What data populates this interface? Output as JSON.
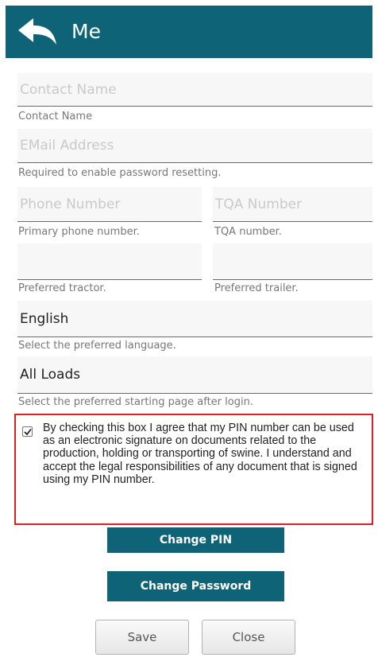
{
  "header": {
    "title": "Me",
    "back_icon": "back-arrow-icon",
    "background": "#0e6377"
  },
  "form": {
    "contact_name": {
      "placeholder": "Contact Name",
      "value": "",
      "hint": "Contact Name"
    },
    "email": {
      "placeholder": "EMail Address",
      "value": "",
      "hint": "Required to enable password resetting."
    },
    "phone": {
      "placeholder": "Phone Number",
      "value": "",
      "hint": "Primary phone number."
    },
    "tqa": {
      "placeholder": "TQA Number",
      "value": "",
      "hint": "TQA number."
    },
    "tractor": {
      "placeholder": "",
      "value": "",
      "hint": "Preferred tractor."
    },
    "trailer": {
      "placeholder": "",
      "value": "",
      "hint": "Preferred trailer."
    },
    "language": {
      "value": "English",
      "hint": "Select the preferred language."
    },
    "start_page": {
      "value": "All Loads",
      "hint": "Select the preferred starting page after login."
    }
  },
  "agreement": {
    "checked": true,
    "text": "By checking this box I agree that my PIN number can be used as an electronic signature on documents related to the production, holding or transporting of swine. I understand and accept the legal responsibilities of any document that is signed using my PIN number.",
    "highlight_color": "#dc2026"
  },
  "buttons": {
    "change_pin": "Change PIN",
    "change_password": "Change Password",
    "save": "Save",
    "close": "Close"
  }
}
